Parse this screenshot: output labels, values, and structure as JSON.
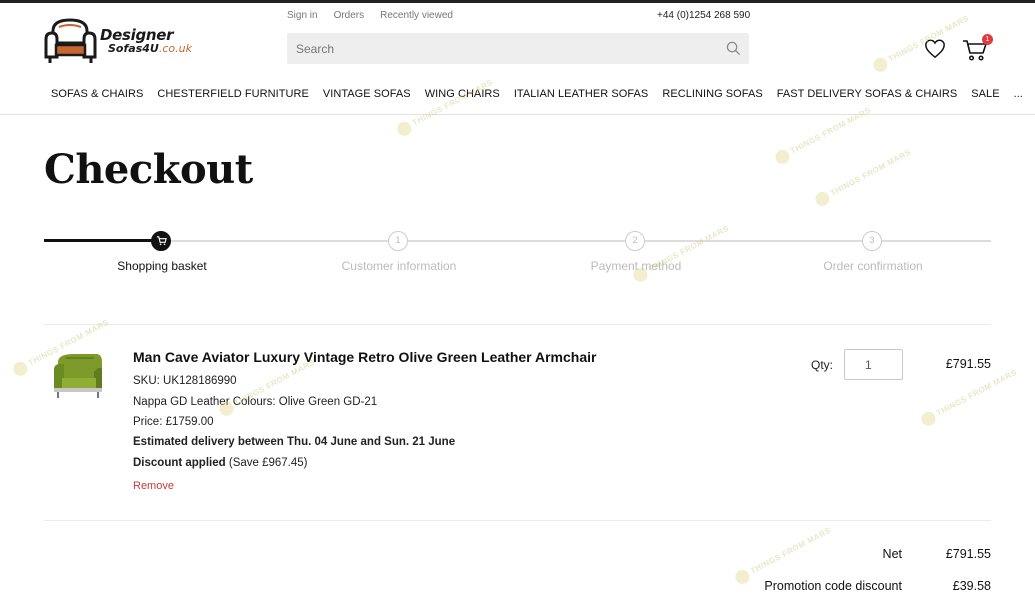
{
  "brand": {
    "line1": "Designer",
    "line2": "Sofas4U",
    "domain": ".co.uk",
    "accent_color": "#c6672e"
  },
  "top_links": [
    "Sign in",
    "Orders",
    "Recently viewed"
  ],
  "phone": "+44 (0)1254 268 590",
  "search": {
    "placeholder": "Search",
    "value": ""
  },
  "cart": {
    "count": "1"
  },
  "nav": [
    "SOFAS & CHAIRS",
    "CHESTERFIELD FURNITURE",
    "VINTAGE SOFAS",
    "WING CHAIRS",
    "ITALIAN LEATHER SOFAS",
    "RECLINING SOFAS",
    "FAST DELIVERY SOFAS & CHAIRS",
    "SALE",
    "..."
  ],
  "page_title": "Checkout",
  "steps": [
    {
      "number": "",
      "label": "Shopping basket",
      "active": true
    },
    {
      "number": "1",
      "label": "Customer information",
      "active": false
    },
    {
      "number": "2",
      "label": "Payment method",
      "active": false
    },
    {
      "number": "3",
      "label": "Order confirmation",
      "active": false
    }
  ],
  "item": {
    "name": "Man Cave Aviator Luxury Vintage Retro Olive Green Leather Armchair",
    "sku": "SKU: UK128186990",
    "colour": "Nappa GD Leather Colours: Olive Green GD-21",
    "price": "Price: £1759.00",
    "delivery": "Estimated delivery between Thu. 04 June and Sun. 21 June",
    "discount_label": "Discount applied",
    "discount_detail": "(Save £967.45)",
    "remove": "Remove",
    "qty_label": "Qty:",
    "qty": "1",
    "total": "£791.55"
  },
  "summary": [
    {
      "label": "Net",
      "value": "£791.55"
    },
    {
      "label": "Promotion code discount",
      "value": "£39.58"
    }
  ],
  "watermark": "THINGS FROM MARS"
}
